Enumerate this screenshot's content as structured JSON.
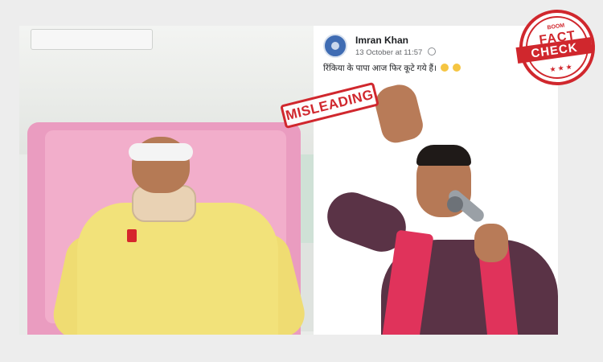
{
  "post": {
    "author": "Imran Khan",
    "timestamp": "13 October at 11:57",
    "text": "रिंकिया के पापा आज फिर कूटे गये हैं।"
  },
  "stamp": {
    "label": "MISLEADING"
  },
  "seal": {
    "brand": "BOOM",
    "top": "FACT",
    "band": "CHECK",
    "stars": "★★★"
  },
  "colors": {
    "stamp_red": "#d0272d",
    "background": "#ededed",
    "bed_pink": "#f2aecb",
    "kurta_yellow": "#f2e27a",
    "kurta_maroon": "#5a3346",
    "scarf_pink": "#e0335b"
  },
  "icons": {
    "avatar": "profile-avatar",
    "privacy": "globe-icon",
    "emojis": "laughing-emoji"
  }
}
